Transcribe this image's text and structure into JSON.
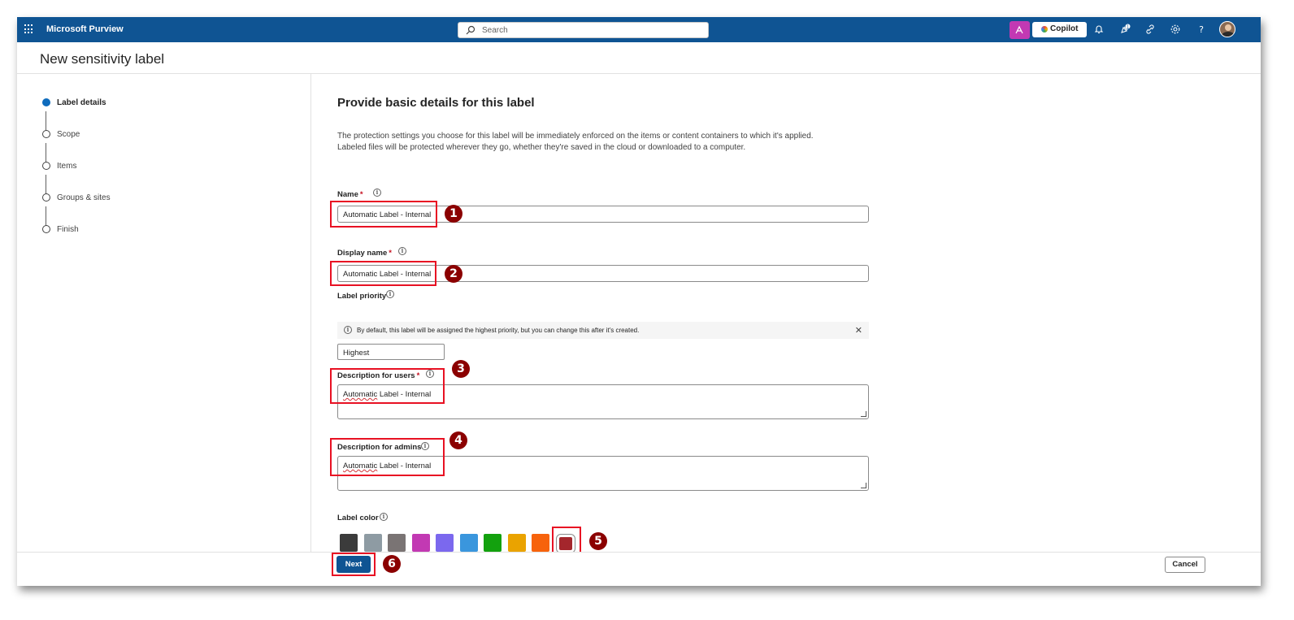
{
  "app": {
    "name": "Microsoft Purview",
    "search_placeholder": "Search",
    "copilot_label": "Copilot",
    "notification_badge": "1"
  },
  "page": {
    "title": "New sensitivity label"
  },
  "steps": [
    {
      "label": "Label details",
      "active": true
    },
    {
      "label": "Scope",
      "active": false
    },
    {
      "label": "Items",
      "active": false
    },
    {
      "label": "Groups & sites",
      "active": false
    },
    {
      "label": "Finish",
      "active": false
    }
  ],
  "main": {
    "heading": "Provide basic details for this label",
    "intro_line1": "The protection settings you choose for this label will be immediately enforced on the items or content containers to which it's applied.",
    "intro_line2": "Labeled files will be protected wherever they go, whether they're saved in the cloud or downloaded to a computer."
  },
  "form": {
    "name_label": "Name",
    "name_value": "Automatic Label - Internal",
    "display_name_label": "Display name",
    "display_name_value": "Automatic Label - Internal",
    "priority_label": "Label priority",
    "priority_message": "By default, this label will be assigned the highest priority, but you can change this after it's created.",
    "priority_value": "Highest",
    "desc_users_label": "Description for users",
    "desc_users_value_word": "Automatic",
    "desc_users_value_rest": " Label - Internal",
    "desc_admins_label": "Description for admins",
    "desc_admins_value_word": "Automatic",
    "desc_admins_value_rest": " Label - Internal",
    "color_label": "Label color",
    "required_mark": "*",
    "colors": [
      "#3b3b3b",
      "#8e9ba3",
      "#7a7474",
      "#c239b3",
      "#7b68ee",
      "#3a96dd",
      "#13a10e",
      "#eaa300",
      "#f7630c",
      "#a4262c"
    ],
    "selected_color_index": 9
  },
  "annotations": [
    "1",
    "2",
    "3",
    "4",
    "5",
    "6"
  ],
  "footer": {
    "next_label": "Next",
    "cancel_label": "Cancel"
  }
}
